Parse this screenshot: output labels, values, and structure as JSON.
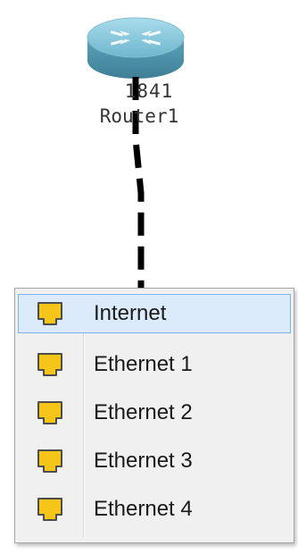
{
  "device": {
    "model": "1841",
    "name": "Router1"
  },
  "port_menu": {
    "items": [
      {
        "label": "Internet",
        "icon": "ethernet-port-icon",
        "selected": true
      },
      {
        "label": "Ethernet 1",
        "icon": "ethernet-port-icon",
        "selected": false
      },
      {
        "label": "Ethernet 2",
        "icon": "ethernet-port-icon",
        "selected": false
      },
      {
        "label": "Ethernet 3",
        "icon": "ethernet-port-icon",
        "selected": false
      },
      {
        "label": "Ethernet 4",
        "icon": "ethernet-port-icon",
        "selected": false
      }
    ]
  },
  "colors": {
    "port_icon_fill": "#f5c518",
    "selection_bg": "#dcebfc",
    "router_body": "#5aa7bf"
  }
}
